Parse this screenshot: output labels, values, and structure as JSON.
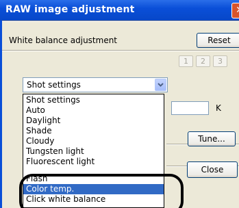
{
  "window": {
    "title": "RAW image adjustment",
    "close_glyph": "✕"
  },
  "white_balance": {
    "label": "White balance adjustment",
    "reset_label": "Reset",
    "presets": [
      "1",
      "2",
      "3"
    ],
    "select": {
      "value": "Shot settings",
      "options": [
        "Shot settings",
        "Auto",
        "Daylight",
        "Shade",
        "Cloudy",
        "Tungsten light",
        "Fluorescent light",
        "Flash",
        "Color temp.",
        "Click white balance"
      ],
      "highlighted": "Color temp."
    },
    "kelvin_unit": "K",
    "kelvin_value": "",
    "tune_label": "Tune...",
    "close_label": "Close"
  },
  "colors": {
    "titlebar": "#0a4fd8",
    "selection": "#316ac5",
    "dialog_bg": "#ece9d8"
  }
}
